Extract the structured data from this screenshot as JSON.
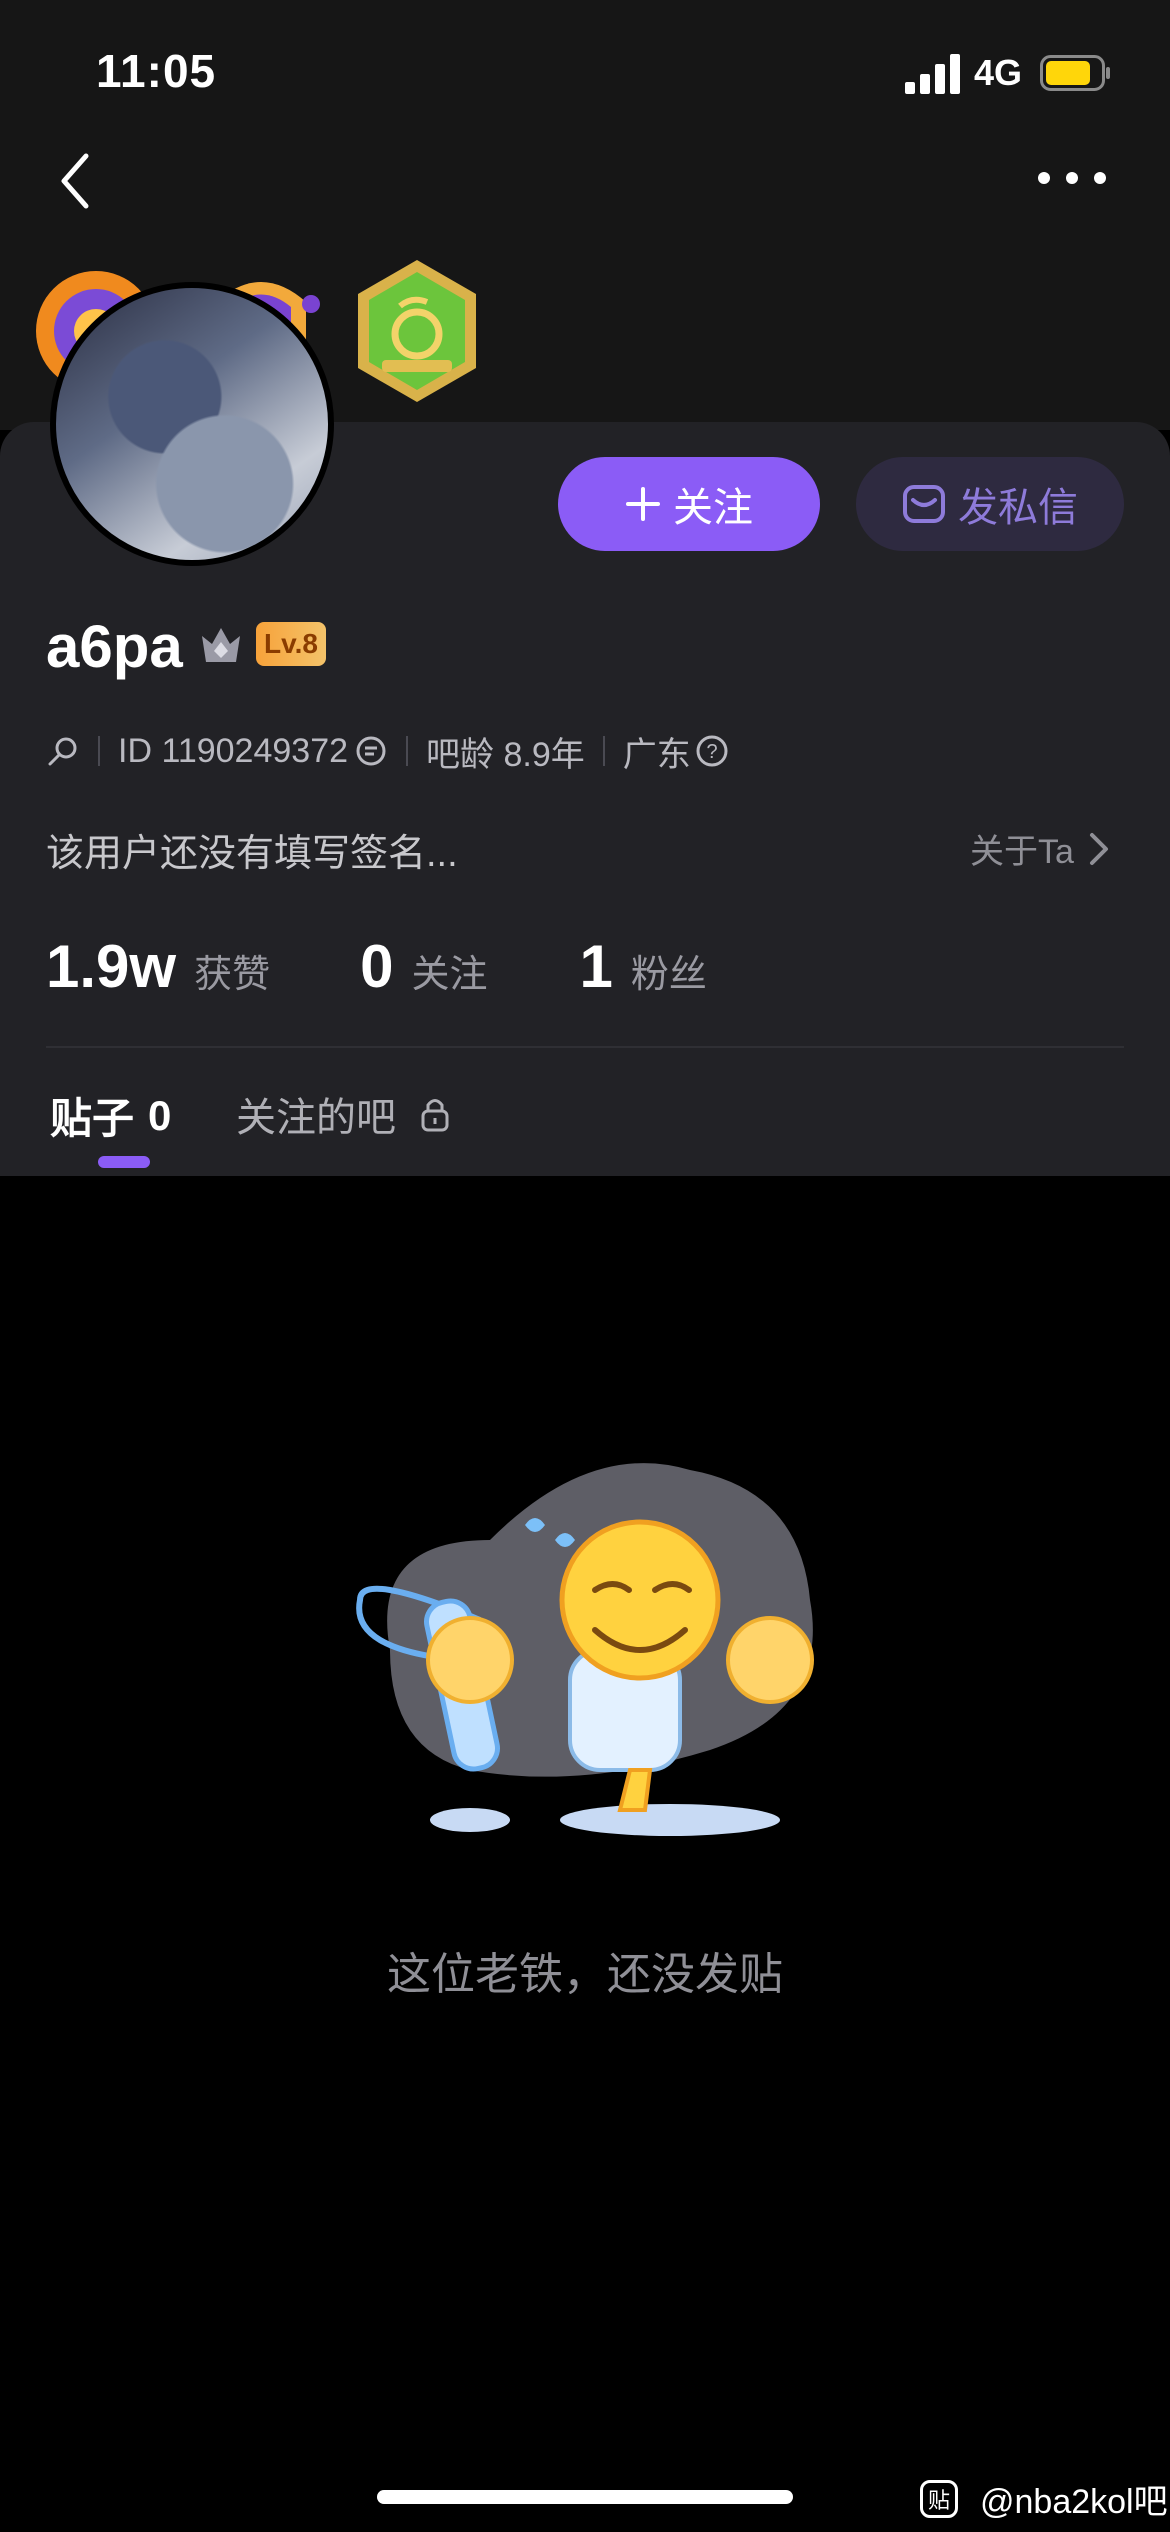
{
  "status_bar": {
    "time": "11:05",
    "network": "4G"
  },
  "profile": {
    "username": "a6pa",
    "level": "Lv.8",
    "id": "ID 1190249372",
    "bar_age": "吧龄 8.9年",
    "location": "广东",
    "signature": "该用户还没有填写签名...",
    "about": "关于Ta"
  },
  "actions": {
    "follow": "关注",
    "message": "发私信"
  },
  "stats": [
    {
      "value": "1.9w",
      "label": "获赞"
    },
    {
      "value": "0",
      "label": "关注"
    },
    {
      "value": "1",
      "label": "粉丝"
    }
  ],
  "tabs": [
    {
      "label": "贴子",
      "count": "0"
    },
    {
      "label": "关注的吧"
    }
  ],
  "empty_state": {
    "text": "这位老铁，还没发贴"
  },
  "watermark": {
    "icon_text": "贴",
    "text": "@nba2kol吧"
  },
  "colors": {
    "accent": "#8B5CF6",
    "level_badge": "#F7A23A",
    "background": "#000000",
    "card": "#222226"
  }
}
